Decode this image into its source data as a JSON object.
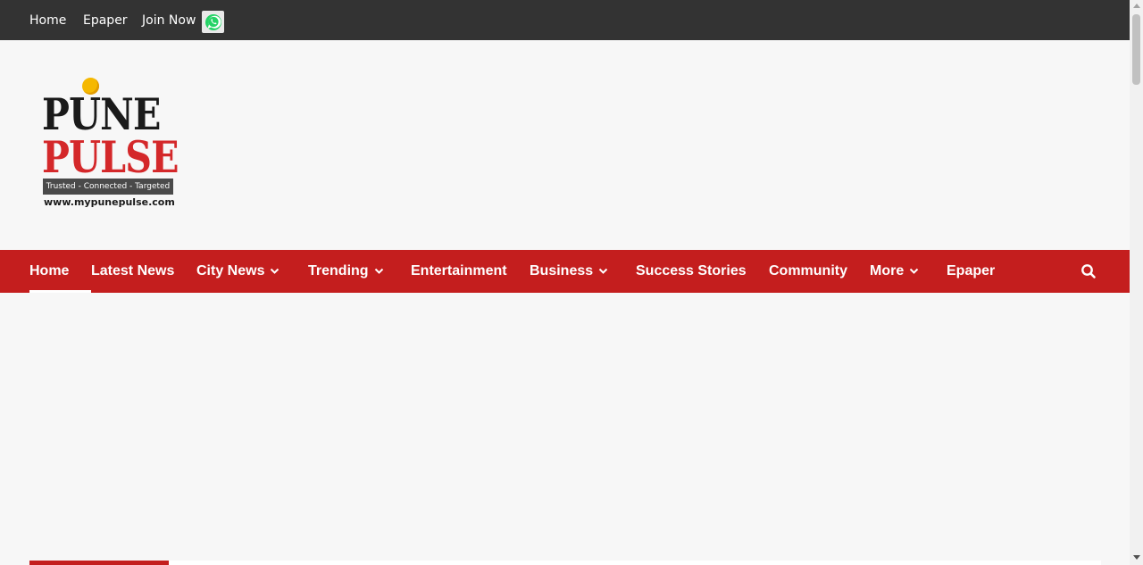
{
  "topbar": {
    "links": [
      "Home",
      "Epaper",
      "Join Now"
    ],
    "whatsapp_icon": "whatsapp-icon"
  },
  "logo": {
    "line1": "PUNE",
    "line2": "PULSE",
    "tagline": "Trusted - Connected - Targeted",
    "url": "www.mypunepulse.com"
  },
  "mainnav": {
    "items": [
      {
        "label": "Home",
        "dropdown": false,
        "active": true
      },
      {
        "label": "Latest News",
        "dropdown": false
      },
      {
        "label": "City News",
        "dropdown": true
      },
      {
        "label": "Trending",
        "dropdown": true
      },
      {
        "label": "Entertainment",
        "dropdown": false
      },
      {
        "label": "Business",
        "dropdown": true
      },
      {
        "label": "Success Stories",
        "dropdown": false
      },
      {
        "label": "Community",
        "dropdown": false
      },
      {
        "label": "More",
        "dropdown": true
      },
      {
        "label": "Epaper",
        "dropdown": false
      }
    ],
    "search_icon": "search-icon"
  },
  "colors": {
    "topbar": "#333333",
    "nav": "#c41e1e",
    "background": "#f7f7f7",
    "brand_red": "#d4282a",
    "brand_yellow": "#f5b800"
  }
}
